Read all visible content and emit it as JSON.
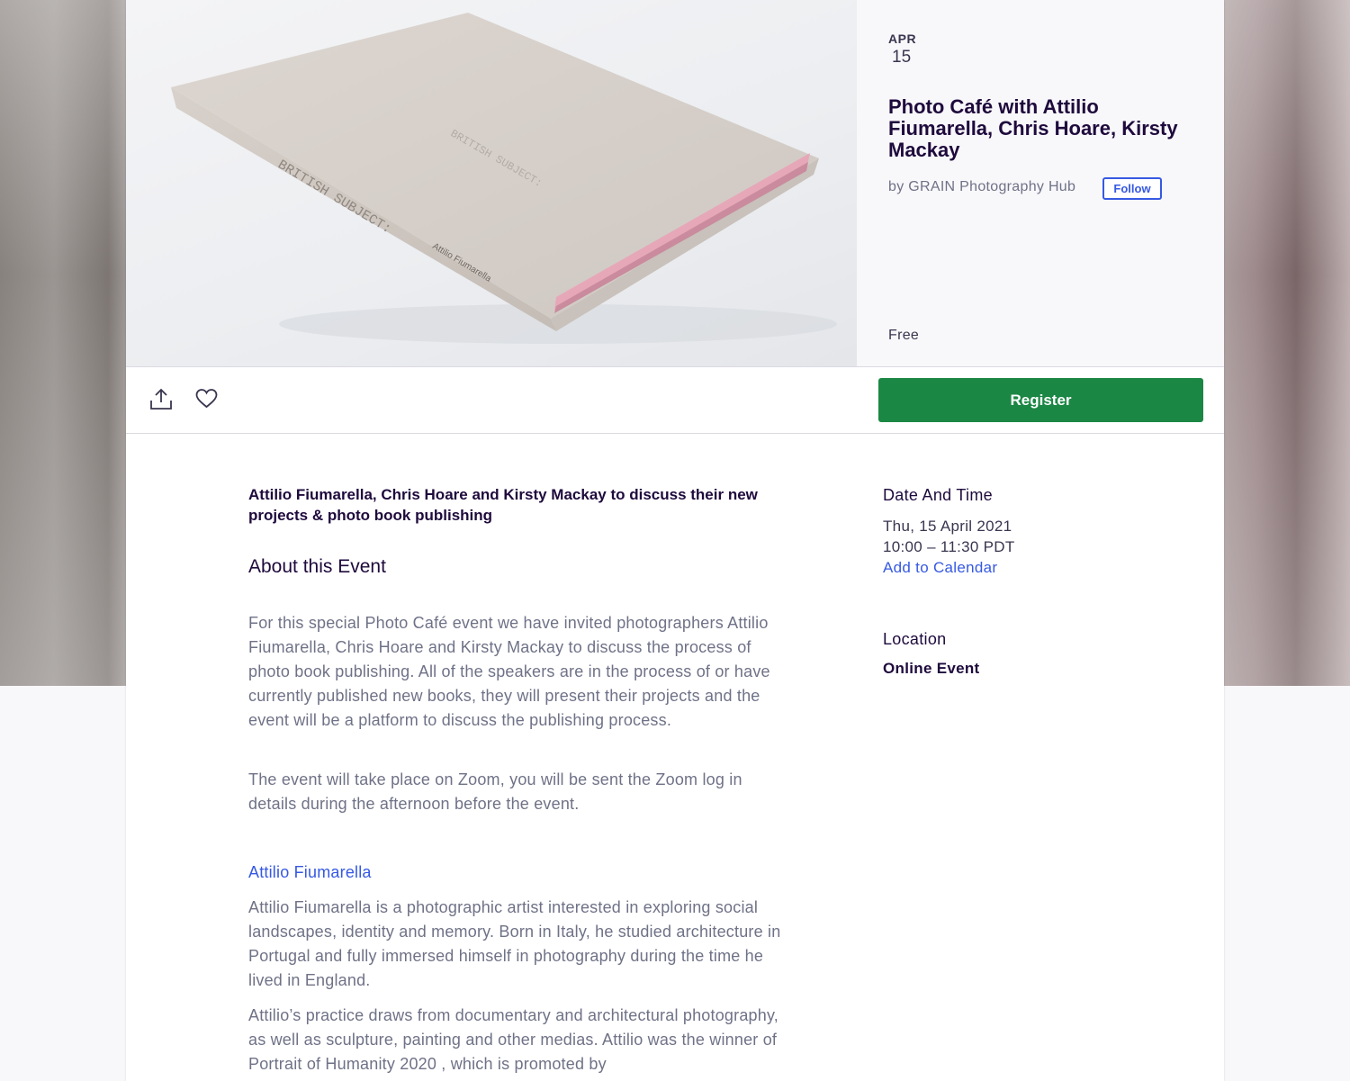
{
  "event": {
    "month": "APR",
    "day": "15",
    "title": "Photo Café with Attilio Fiumarella, Chris Hoare, Kirsty Mackay",
    "organizer": "by GRAIN Photography Hub",
    "follow_label": "Follow",
    "price": "Free",
    "image_label": "Book cover image",
    "cover_text": "BRITISH SUBJECT:",
    "cover_author": "Attilio Fiumarella"
  },
  "actions": {
    "share_icon": "share-icon",
    "like_icon": "heart-icon",
    "register_label": "Register"
  },
  "main": {
    "summary": "Attilio Fiumarella, Chris Hoare and Kirsty Mackay to discuss their new projects & photo book publishing",
    "about_heading": "About this Event",
    "para1": "For this special Photo Café event we have invited photographers Attilio Fiumarella, Chris Hoare and Kirsty Mackay to discuss the process of photo book publishing. All of the speakers are in the process of or have currently published new books, they will present their projects and the event will be a platform to discuss the publishing process.",
    "para2": "The event will take place on Zoom, you will be sent the Zoom log in details during the afternoon before the event.",
    "speaker_link": "Attilio Fiumarella",
    "para3": "Attilio Fiumarella is a photographic artist interested in exploring social landscapes, identity and memory. Born in Italy, he studied architecture in Portugal and fully immersed himself in photography during the time he lived in England.",
    "para4": "Attilio’s practice draws from documentary and architectural photography, as well as sculpture, painting and other medias. Attilio was the winner of Portrait of Humanity 2020 , which is promoted by"
  },
  "aside": {
    "date_heading": "Date And Time",
    "date_line": "Thu, 15 April 2021",
    "time_line": "10:00 – 11:30 PDT",
    "calendar_link": "Add to Calendar",
    "location_heading": "Location",
    "location_value": "Online Event"
  }
}
